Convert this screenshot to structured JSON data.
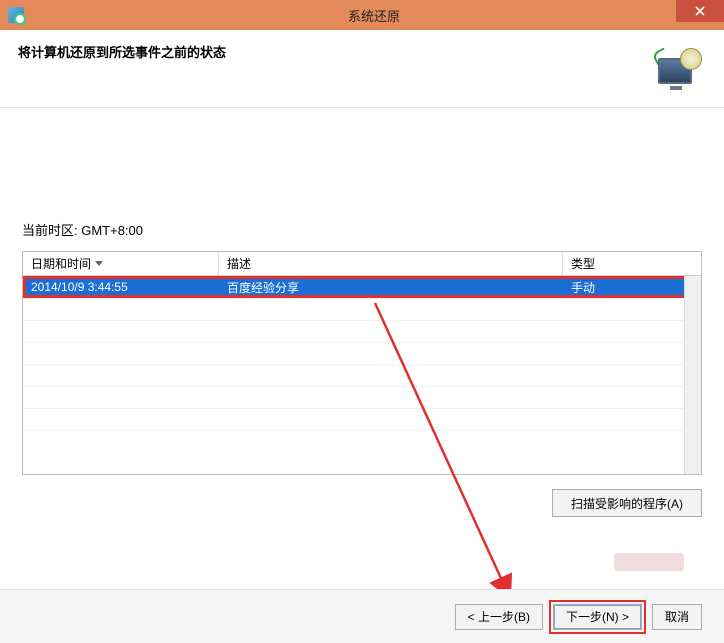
{
  "titlebar": {
    "title": "系统还原"
  },
  "header": {
    "text": "将计算机还原到所选事件之前的状态"
  },
  "timezone_label": "当前时区: GMT+8:00",
  "table": {
    "columns": {
      "datetime": "日期和时间",
      "description": "描述",
      "type": "类型"
    },
    "rows": [
      {
        "datetime": "2014/10/9 3:44:55",
        "description": "百度经验分享",
        "type": "手动",
        "selected": true
      }
    ]
  },
  "buttons": {
    "scan": "扫描受影响的程序(A)",
    "back": "< 上一步(B)",
    "next": "下一步(N) >",
    "cancel": "取消"
  }
}
